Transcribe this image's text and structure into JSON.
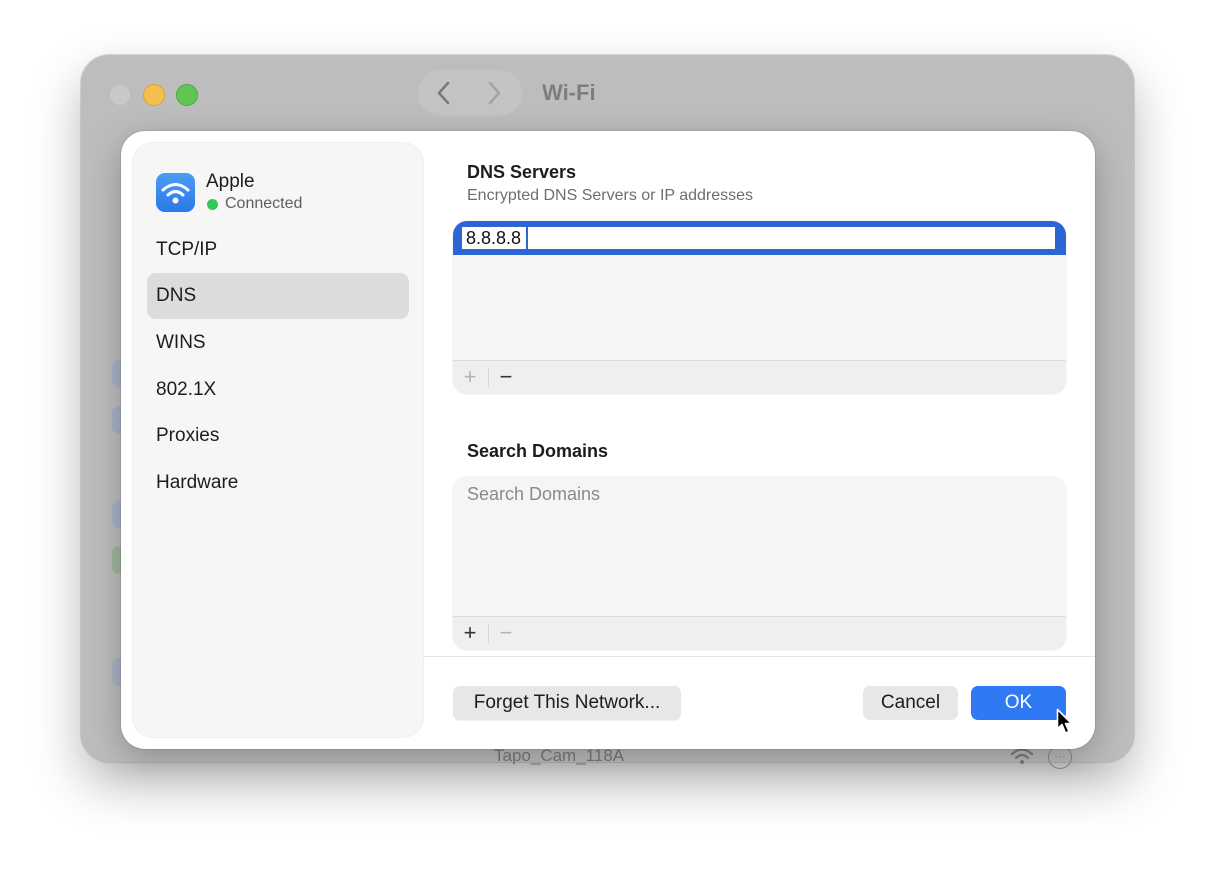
{
  "background_window": {
    "title": "Wi-Fi",
    "partial_network_row": "Tapo_Cam_118A",
    "more_label": "···"
  },
  "sidebar": {
    "network": {
      "name": "Apple",
      "status": "Connected"
    },
    "items": [
      {
        "label": "TCP/IP",
        "selected": false
      },
      {
        "label": "DNS",
        "selected": true
      },
      {
        "label": "WINS",
        "selected": false
      },
      {
        "label": "802.1X",
        "selected": false
      },
      {
        "label": "Proxies",
        "selected": false
      },
      {
        "label": "Hardware",
        "selected": false
      }
    ]
  },
  "dns": {
    "title": "DNS Servers",
    "subtitle": "Encrypted DNS Servers or IP addresses",
    "entries": [
      "8.8.8.8"
    ],
    "add_label": "+",
    "remove_label": "−"
  },
  "search_domains": {
    "title": "Search Domains",
    "placeholder": "Search Domains",
    "add_label": "+",
    "remove_label": "−"
  },
  "footer": {
    "forget_label": "Forget This Network...",
    "cancel_label": "Cancel",
    "ok_label": "OK"
  },
  "colors": {
    "accent": "#2f79f4",
    "selection": "#2c66d5",
    "connected": "#34c759"
  }
}
